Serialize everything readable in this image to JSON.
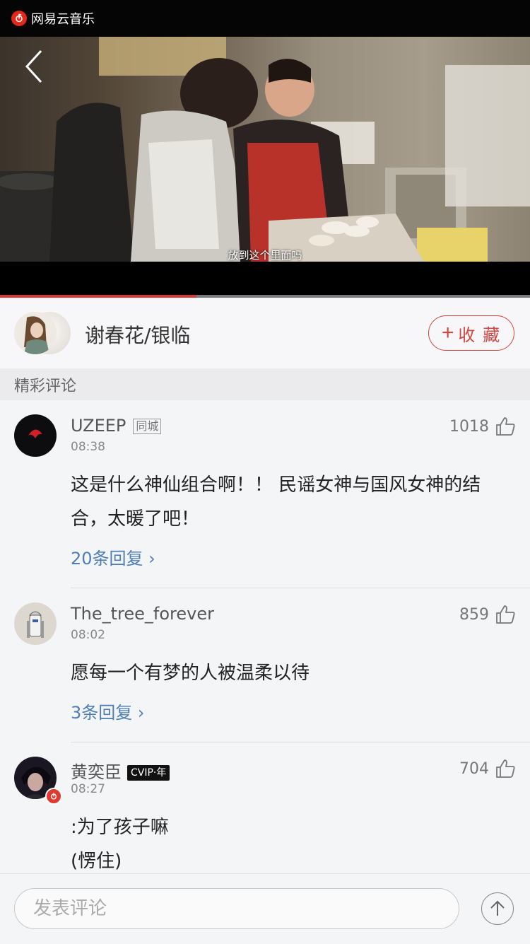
{
  "app": {
    "name": "网易云音乐"
  },
  "video": {
    "subtitle": "放到这个里面吗",
    "progress": 0.37
  },
  "singer": {
    "name": "谢春花/银临",
    "collect_label": "收 藏"
  },
  "section": {
    "title": "精彩评论"
  },
  "comments": [
    {
      "user": "UZEEP",
      "tag": "同城",
      "time": "08:38",
      "likes": "1018",
      "text": "这是什么神仙组合啊！！ 民谣女神与国风女神的结合，太暖了吧！",
      "replies": "20条回复 ›"
    },
    {
      "user": "The_tree_forever",
      "time": "08:02",
      "likes": "859",
      "text": "愿每一个有梦的人被温柔以待",
      "replies": "3条回复 ›"
    },
    {
      "user": "黄奕臣",
      "vip": "CVIP·年",
      "time": "08:27",
      "likes": "704",
      "text_line1": ":为了孩子嘛",
      "text_line2": "(愣住)"
    }
  ],
  "input": {
    "placeholder": "发表评论"
  },
  "colors": {
    "accent": "#d3463f",
    "link": "#4e7eb7",
    "logo": "#e2281b"
  },
  "icons": [
    "netease-logo-icon",
    "back-chevron-icon",
    "plus-icon",
    "thumbs-up-icon",
    "arrow-up-icon"
  ]
}
